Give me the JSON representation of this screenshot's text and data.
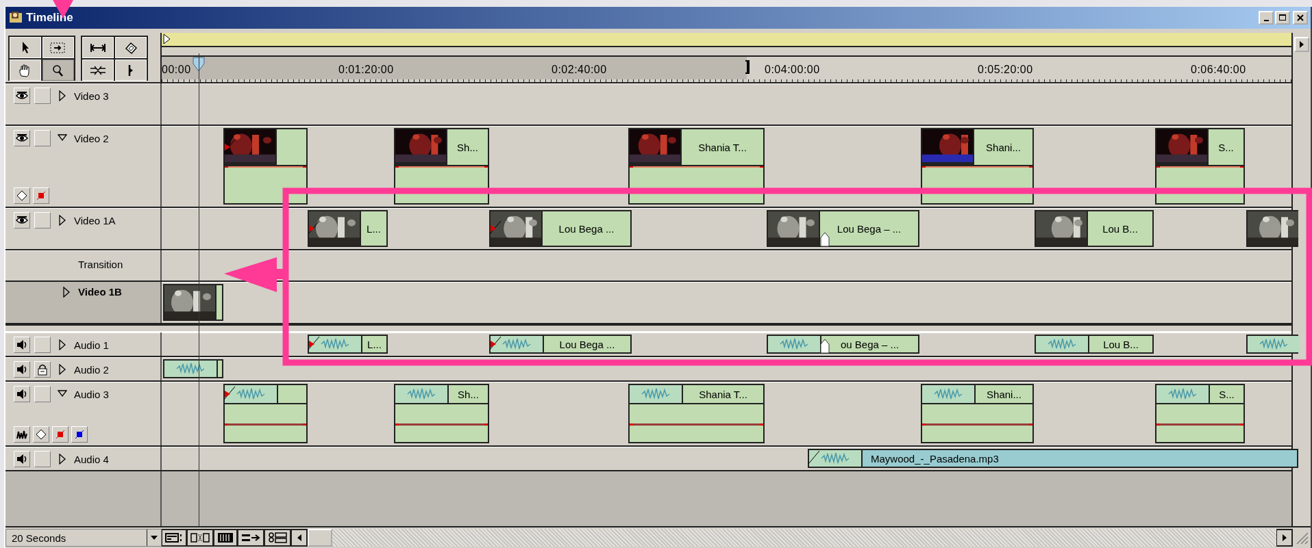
{
  "window": {
    "title": "Timeline"
  },
  "tools": [
    {
      "kind": "arrow",
      "selected": false
    },
    {
      "kind": "marquee",
      "selected": false
    },
    {
      "kind": "hand",
      "selected": false
    },
    {
      "kind": "zoom",
      "selected": true
    },
    {
      "kind": "stretch",
      "selected": false
    },
    {
      "kind": "film",
      "selected": false
    },
    {
      "kind": "cross",
      "selected": false
    },
    {
      "kind": "marker",
      "selected": false
    }
  ],
  "ruler": {
    "labels": [
      "00:00",
      "0:01:20:00",
      "0:02:40:00",
      "0:04:00:00",
      "0:05:20:00",
      "0:06:40:00"
    ]
  },
  "tracks": [
    {
      "name": "Video 3",
      "kind": "video",
      "expanded": false,
      "selected": false,
      "locked": false
    },
    {
      "name": "Video 2",
      "kind": "video",
      "expanded": true,
      "selected": false,
      "locked": false,
      "clips": [
        {
          "kind": "clip",
          "in_marker": true,
          "edit_marker": false
        },
        {
          "kind": "clip",
          "label": "Sh...",
          "in_marker": false,
          "edit_marker": false
        },
        {
          "kind": "clip",
          "label": "Shania T...",
          "in_marker": false,
          "edit_marker": false
        },
        {
          "kind": "clip",
          "label": "Shani...",
          "in_marker": false,
          "edit_marker": false
        },
        {
          "kind": "clip",
          "label": "S...",
          "in_marker": false,
          "edit_marker": false
        }
      ]
    },
    {
      "name": "Video 1A",
      "kind": "video",
      "expanded": false,
      "selected": false,
      "locked": false,
      "clips": [
        {
          "kind": "clip",
          "label": "L...",
          "in_marker": true,
          "edit_marker": false
        },
        {
          "kind": "clip",
          "label": "Lou Bega ...",
          "in_marker": true,
          "edit_marker": false
        },
        {
          "kind": "clip",
          "label": "Lou Bega – ...",
          "in_marker": false,
          "edit_marker": true
        },
        {
          "kind": "clip",
          "label": "Lou B...",
          "in_marker": false,
          "edit_marker": false
        },
        {
          "kind": "clip",
          "in_marker": false,
          "edit_marker": false
        }
      ]
    },
    {
      "name": "Transition",
      "kind": "transition"
    },
    {
      "name": "Video 1B",
      "kind": "video_b",
      "expanded": false,
      "selected": true,
      "clips": [
        {
          "kind": "clip",
          "in_marker": false,
          "edit_marker": false
        }
      ]
    },
    {
      "name": "Audio 1",
      "kind": "audio",
      "expanded": false,
      "selected": false,
      "locked": false,
      "clips": [
        {
          "kind": "clip",
          "label": "L...",
          "in_marker": true,
          "edit_marker": false
        },
        {
          "kind": "clip",
          "label": "Lou Bega ...",
          "in_marker": true,
          "edit_marker": false
        },
        {
          "kind": "clip",
          "label": "ou Bega – ...",
          "in_marker": false,
          "edit_marker": true
        },
        {
          "kind": "clip",
          "label": "Lou B...",
          "in_marker": false,
          "edit_marker": false
        },
        {
          "kind": "clip",
          "in_marker": false,
          "edit_marker": false
        }
      ]
    },
    {
      "name": "Audio 2",
      "kind": "audio",
      "expanded": false,
      "selected": false,
      "locked": true,
      "clips": [
        {
          "kind": "clip",
          "in_marker": false,
          "edit_marker": false
        }
      ]
    },
    {
      "name": "Audio 3",
      "kind": "audio",
      "expanded": true,
      "selected": false,
      "locked": false,
      "clips": [
        {
          "kind": "clip",
          "in_marker": true,
          "edit_marker": false
        },
        {
          "kind": "clip",
          "label": "Sh...",
          "in_marker": false,
          "edit_marker": false
        },
        {
          "kind": "clip",
          "label": "Shania T...",
          "in_marker": false,
          "edit_marker": false
        },
        {
          "kind": "clip",
          "label": "Shani...",
          "in_marker": false,
          "edit_marker": false
        },
        {
          "kind": "clip",
          "label": "S...",
          "in_marker": false,
          "edit_marker": false
        }
      ]
    },
    {
      "name": "Audio 4",
      "kind": "audio",
      "expanded": false,
      "selected": false,
      "locked": false,
      "clips": [
        {
          "kind": "file",
          "label": "Maywood_-_Pasadena.mp3",
          "in_marker": true,
          "edit_marker": false
        }
      ]
    }
  ],
  "status_bar": {
    "zoom": "20 Seconds"
  }
}
